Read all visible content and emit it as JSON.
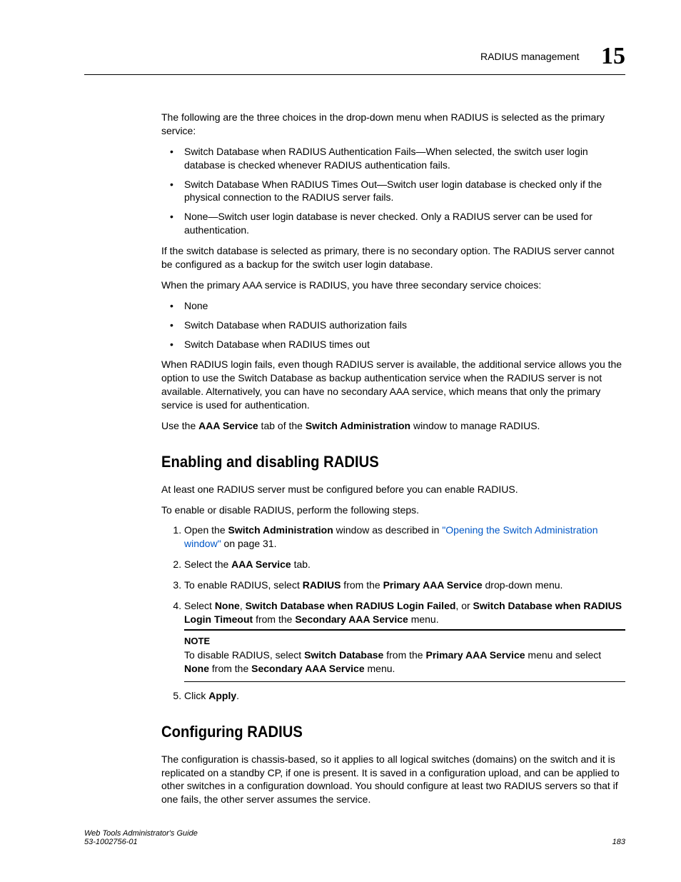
{
  "header": {
    "section_label": "RADIUS management",
    "chapter_number": "15"
  },
  "body": {
    "intro1": "The following are the three choices in the drop-down menu when RADIUS is selected as the primary service:",
    "choices1": [
      "Switch Database when RADIUS Authentication Fails—When selected, the switch user login database is checked whenever RADIUS authentication fails.",
      "Switch Database When RADIUS Times Out—Switch user login database is checked only if the physical connection to the RADIUS server fails.",
      "None—Switch user login database is never checked. Only a RADIUS server can be used for authentication."
    ],
    "para2": "If the switch database is selected as primary, there is no secondary option. The RADIUS server cannot be configured as a backup for the switch user login database.",
    "para3": "When the primary AAA service is RADIUS, you have three secondary service choices:",
    "choices2": [
      "None",
      "Switch Database when RADUIS authorization fails",
      "Switch Database when RADIUS times out"
    ],
    "para4": "When RADIUS login fails, even though RADIUS server is available, the additional service allows you the option to use the Switch Database as backup authentication service when the RADIUS server is not available. Alternatively, you can have no secondary AAA service, which means that only the primary service is used for authentication.",
    "para5_pre": "Use the ",
    "para5_b1": "AAA Service",
    "para5_mid": " tab of the ",
    "para5_b2": "Switch Administration",
    "para5_post": " window to manage RADIUS.",
    "section1_title": "Enabling and disabling RADIUS",
    "s1_p1": "At least one RADIUS server must be configured before you can enable RADIUS.",
    "s1_p2": "To enable or disable RADIUS, perform the following steps.",
    "step1_pre": "Open the ",
    "step1_b": "Switch Administration",
    "step1_mid": " window as described in ",
    "step1_link": "\"Opening the Switch Administration window\"",
    "step1_post": " on page 31.",
    "step2_pre": "Select the ",
    "step2_b": "AAA Service",
    "step2_post": " tab.",
    "step3_pre": "To enable RADIUS, select ",
    "step3_b1": "RADIUS",
    "step3_mid": " from the ",
    "step3_b2": "Primary AAA Service",
    "step3_post": " drop-down menu.",
    "step4_pre": "Select ",
    "step4_b1": "None",
    "step4_c1": ", ",
    "step4_b2": "Switch Database when RADIUS Login Failed",
    "step4_c2": ", or ",
    "step4_b3": "Switch Database when RADIUS Login Timeout",
    "step4_mid": " from the ",
    "step4_b4": "Secondary AAA Service",
    "step4_post": " menu.",
    "note_label": "NOTE",
    "note_pre": "To disable RADIUS, select ",
    "note_b1": "Switch Database",
    "note_mid1": " from the ",
    "note_b2": "Primary AAA Service",
    "note_mid2": " menu and select ",
    "note_b3": "None",
    "note_mid3": " from the ",
    "note_b4": "Secondary AAA Service",
    "note_post": " menu.",
    "step5_pre": "Click ",
    "step5_b": "Apply",
    "step5_post": ".",
    "section2_title": "Configuring RADIUS",
    "s2_p1": "The configuration is chassis-based, so it applies to all logical switches (domains) on the switch and it is replicated on a standby CP, if one is present. It is saved in a configuration upload, and can be applied to other switches in a configuration download. You should configure at least two RADIUS servers so that if one fails, the other server assumes the service."
  },
  "footer": {
    "guide": "Web Tools Administrator's Guide",
    "docnum": "53-1002756-01",
    "page": "183"
  }
}
